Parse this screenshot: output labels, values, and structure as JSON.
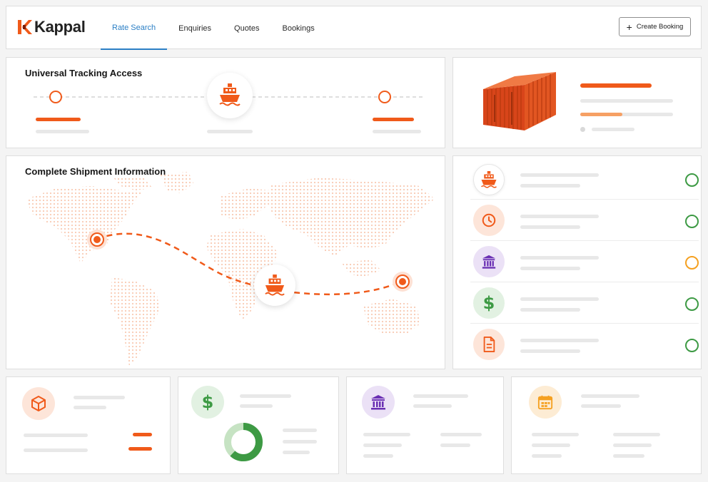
{
  "brand": {
    "name": "Kappal",
    "color": "#f05a1a"
  },
  "nav": {
    "items": [
      {
        "label": "Rate Search",
        "active": true
      },
      {
        "label": "Enquiries",
        "active": false
      },
      {
        "label": "Quotes",
        "active": false
      },
      {
        "label": "Bookings",
        "active": false
      }
    ]
  },
  "toolbar": {
    "create_booking_label": "Create Booking",
    "create_booking_icon": "plus-icon"
  },
  "tracking": {
    "title": "Universal Tracking Access",
    "center_icon": "ship-icon"
  },
  "container_card": {
    "image": "shipping-container-image",
    "progress_fraction": 0.45
  },
  "map_card": {
    "title": "Complete Shipment Information",
    "vessel_icon": "ship-icon"
  },
  "status_list": [
    {
      "icon": "ship-icon",
      "status_color": "#3d9a44"
    },
    {
      "icon": "clock-icon",
      "status_color": "#3d9a44"
    },
    {
      "icon": "customs-building-icon",
      "status_color": "#3d9a44"
    },
    {
      "icon": "dollar-icon",
      "status_color": "#3d9a44"
    },
    {
      "icon": "document-icon",
      "status_color": "#3d9a44"
    }
  ],
  "bottom_cards": [
    {
      "icon": "box-icon",
      "accent": "#f05a1a"
    },
    {
      "icon": "dollar-icon",
      "accent": "#3d9a44",
      "donut_fraction": 0.62
    },
    {
      "icon": "customs-building-icon",
      "accent": "#6a2fb3"
    },
    {
      "icon": "calendar-icon",
      "accent": "#f5a020"
    }
  ],
  "colors": {
    "accent": "#f05a1a",
    "nav_active": "#2b7fc5",
    "success": "#3d9a44",
    "warning": "#f5a020",
    "purple": "#6a2fb3"
  }
}
